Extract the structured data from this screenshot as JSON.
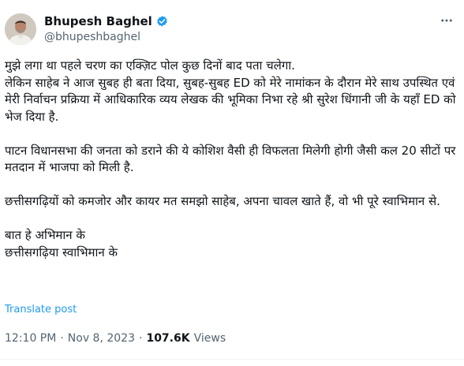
{
  "user": {
    "display_name": "Bhupesh Baghel",
    "handle": "@bhupeshbaghel",
    "verified": true
  },
  "tweet": {
    "paragraphs": [
      "मुझे लगा था पहले चरण का एक्ज़िट पोल कुछ दिनों बाद पता चलेगा.\nलेकिन साहेब ने आज सुबह ही बता दिया, सुबह-सुबह ED को मेरे नामांकन के दौरान मेरे साथ उपस्थित एवं मेरी निर्वाचन प्रक्रिया में आधिकारिक व्यय लेखक की भूमिका निभा रहे श्री सुरेश धिंगानी जी के यहाँ ED को भेज दिया है.",
      "पाटन विधानसभा की जनता को डराने की ये कोशिश वैसी ही विफलता मिलेगी होगी जैसी कल 20 सीटों पर मतदान में भाजपा को मिली है.",
      "छत्तीसगढ़ियों को कमजोर और कायर मत समझो साहेब, अपना चावल खाते हैं, वो भी पूरे स्वाभिमान से.",
      "बात हे अभिमान के\nछत्तीसगढ़िया स्वाभिमान के"
    ],
    "translate_label": "Translate post",
    "time": "12:10 PM",
    "separator": "·",
    "date": "Nov 8, 2023",
    "views_count": "107.6K",
    "views_label": "Views"
  },
  "icons": {
    "verified": "verified-badge-icon",
    "more": "more-options-icon"
  },
  "colors": {
    "accent": "#1d9bf0",
    "text": "#0f1419",
    "secondary": "#536471"
  }
}
